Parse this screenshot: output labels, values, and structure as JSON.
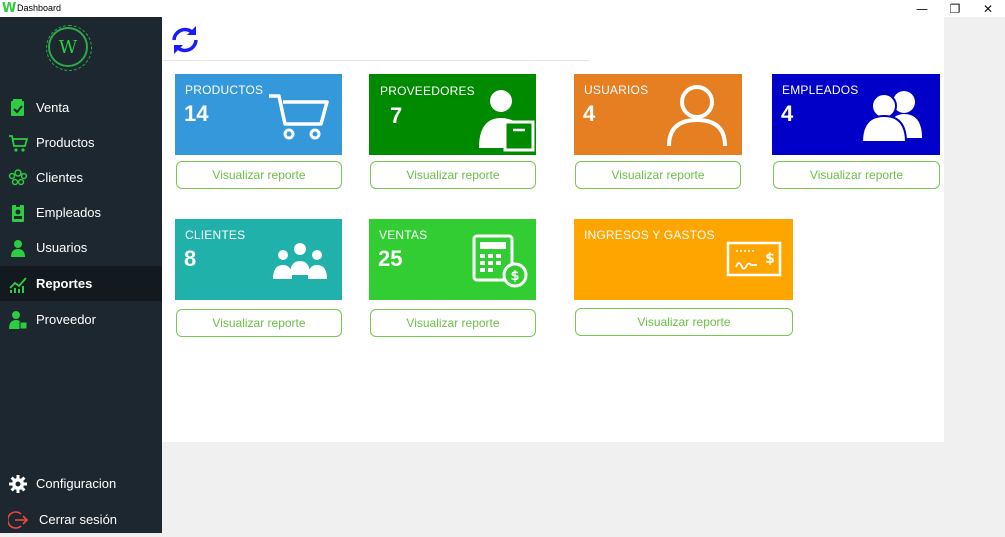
{
  "window": {
    "logo": "W",
    "title": "Dashboard",
    "controls": {
      "minimize": "—",
      "maximize": "❐",
      "close": "✕"
    }
  },
  "sidebar": {
    "logo_letter": "W",
    "items": [
      {
        "label": "Venta",
        "icon": "cart-receipt-icon"
      },
      {
        "label": "Productos",
        "icon": "shopping-cart-icon"
      },
      {
        "label": "Clientes",
        "icon": "people-icon"
      },
      {
        "label": "Empleados",
        "icon": "id-badge-icon"
      },
      {
        "label": "Usuarios",
        "icon": "user-icon"
      },
      {
        "label": "Reportes",
        "icon": "chart-icon",
        "active": true
      },
      {
        "label": "Proveedor",
        "icon": "supplier-icon"
      }
    ],
    "footer": [
      {
        "label": "Configuracion",
        "icon": "gear-icon"
      },
      {
        "label": "Cerrar sesión",
        "icon": "logout-icon"
      }
    ]
  },
  "tiles": [
    {
      "title": "PRODUCTOS",
      "value": "14",
      "color": "#3498db",
      "icon": "cart-icon",
      "button": "Visualizar reporte"
    },
    {
      "title": "PROVEEDORES",
      "value": "7",
      "color": "#008a00",
      "icon": "supplier-box-icon",
      "button": "Visualizar reporte"
    },
    {
      "title": "USUARIOS",
      "value": "4",
      "color": "#e67e22",
      "icon": "user-outline-icon",
      "button": "Visualizar reporte"
    },
    {
      "title": "EMPLEADOS",
      "value": "4",
      "color": "#0000c8",
      "icon": "two-people-icon",
      "button": "Visualizar reporte"
    },
    {
      "title": "CLIENTES",
      "value": "8",
      "color": "#20b2aa",
      "icon": "group-icon",
      "button": "Visualizar reporte"
    },
    {
      "title": "VENTAS",
      "value": "25",
      "color": "#32cd32",
      "icon": "calculator-icon",
      "button": "Visualizar reporte"
    },
    {
      "title": "INGRESOS Y GASTOS",
      "value": "",
      "color": "#ffa500",
      "icon": "check-icon",
      "button": "Visualizar reporte"
    }
  ],
  "colors": {
    "sidebar_bg": "#1c272f",
    "accent_green": "#2ecc40",
    "button_border": "#7ac74f",
    "refresh": "#1a1aff"
  }
}
